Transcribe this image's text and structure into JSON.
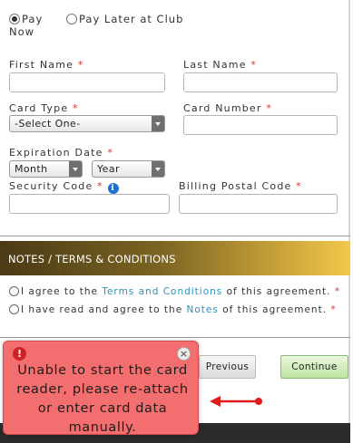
{
  "payment_options": {
    "pay_now": "Pay Now",
    "pay_later": "Pay Later at Club",
    "selected": "pay_now"
  },
  "form": {
    "first_name_label": "First Name",
    "last_name_label": "Last Name",
    "card_type_label": "Card Type",
    "card_type_value": "-Select One-",
    "card_number_label": "Card Number",
    "expiration_label": "Expiration Date",
    "month_value": "Month",
    "year_value": "Year",
    "security_code_label": "Security Code",
    "billing_postal_label": "Billing Postal Code",
    "required_marker": "*"
  },
  "notes": {
    "header": "NOTES / TERMS & CONDITIONS",
    "agree_terms_prefix": "I agree to the",
    "agree_terms_link": "Terms and Conditions",
    "agree_terms_suffix": "of this agreement.",
    "agree_notes_prefix": "I have read and agree to the",
    "agree_notes_link": "Notes",
    "agree_notes_suffix": "of this agreement."
  },
  "buttons": {
    "previous": "Previous",
    "continue": "Continue"
  },
  "toast": {
    "message": "Unable to start the card reader, please re-attach or enter card data manually.",
    "alert_symbol": "!",
    "close_symbol": "×"
  },
  "colors": {
    "required": "#d9302c",
    "link": "#2a90b8",
    "toast_bg": "#f36e6e",
    "arrow": "#e01b1b",
    "continue_bg": "#bfe3a3"
  },
  "icons": {
    "info": "info-icon",
    "alert": "alert-icon",
    "close": "close-icon",
    "arrow": "arrow-left-icon"
  }
}
